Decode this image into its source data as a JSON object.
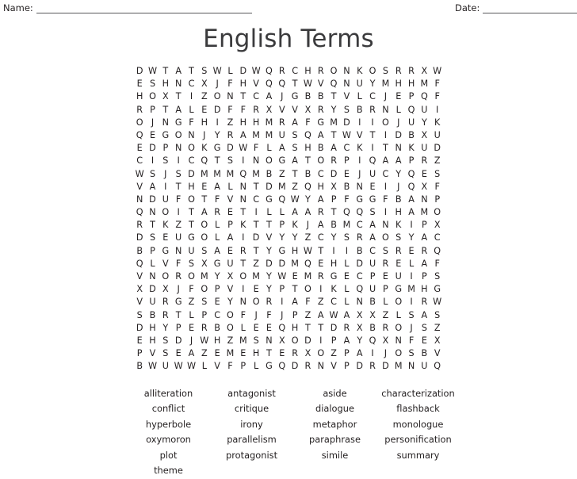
{
  "header": {
    "name_label": "Name:",
    "date_label": "Date:"
  },
  "title": "English Terms",
  "grid": {
    "columns": 24,
    "rows": [
      [
        "D",
        "W",
        "T",
        "A",
        "T",
        "S",
        "W",
        "L",
        "D",
        "W",
        "Q",
        "R",
        "C",
        "H",
        "R",
        "O",
        "N",
        "K",
        "O",
        "S",
        "R",
        "R",
        "X",
        "W"
      ],
      [
        "E",
        "S",
        "H",
        "N",
        "C",
        "X",
        "J",
        "F",
        "H",
        "V",
        "Q",
        "Q",
        "T",
        "W",
        "V",
        "Q",
        "N",
        "U",
        "Y",
        "M",
        "H",
        "H",
        "M",
        "F"
      ],
      [
        "H",
        "O",
        "X",
        "T",
        "I",
        "Z",
        "O",
        "N",
        "T",
        "C",
        "A",
        "J",
        "G",
        "B",
        "B",
        "T",
        "V",
        "L",
        "C",
        "J",
        "E",
        "P",
        "Q",
        "F"
      ],
      [
        "R",
        "P",
        "T",
        "A",
        "L",
        "E",
        "D",
        "F",
        "F",
        "R",
        "X",
        "V",
        "V",
        "X",
        "R",
        "Y",
        "S",
        "B",
        "R",
        "N",
        "L",
        "Q",
        "U",
        "I"
      ],
      [
        "O",
        "J",
        "N",
        "G",
        "F",
        "H",
        "I",
        "Z",
        "H",
        "H",
        "M",
        "R",
        "A",
        "F",
        "G",
        "M",
        "D",
        "I",
        "I",
        "O",
        "J",
        "U",
        "Y",
        "K"
      ],
      [
        "Q",
        "E",
        "G",
        "O",
        "N",
        "J",
        "Y",
        "R",
        "A",
        "M",
        "M",
        "U",
        "S",
        "Q",
        "A",
        "T",
        "W",
        "V",
        "T",
        "I",
        "D",
        "B",
        "X",
        "U"
      ],
      [
        "E",
        "D",
        "P",
        "N",
        "O",
        "K",
        "G",
        "D",
        "W",
        "F",
        "L",
        "A",
        "S",
        "H",
        "B",
        "A",
        "C",
        "K",
        "I",
        "T",
        "N",
        "K",
        "U",
        "D"
      ],
      [
        "C",
        "I",
        "S",
        "I",
        "C",
        "Q",
        "T",
        "S",
        "I",
        "N",
        "O",
        "G",
        "A",
        "T",
        "O",
        "R",
        "P",
        "I",
        "Q",
        "A",
        "A",
        "P",
        "R",
        "Z"
      ],
      [
        "W",
        "S",
        "J",
        "S",
        "D",
        "M",
        "M",
        "M",
        "Q",
        "M",
        "B",
        "Z",
        "T",
        "B",
        "C",
        "D",
        "E",
        "J",
        "U",
        "C",
        "Y",
        "Q",
        "E",
        "S"
      ],
      [
        "V",
        "A",
        "I",
        "T",
        "H",
        "E",
        "A",
        "L",
        "N",
        "T",
        "D",
        "M",
        "Z",
        "Q",
        "H",
        "X",
        "B",
        "N",
        "E",
        "I",
        "J",
        "Q",
        "X",
        "F"
      ],
      [
        "N",
        "D",
        "U",
        "F",
        "O",
        "T",
        "F",
        "V",
        "N",
        "C",
        "G",
        "Q",
        "W",
        "Y",
        "A",
        "P",
        "F",
        "G",
        "G",
        "F",
        "B",
        "A",
        "N",
        "P"
      ],
      [
        "Q",
        "N",
        "O",
        "I",
        "T",
        "A",
        "R",
        "E",
        "T",
        "I",
        "L",
        "L",
        "A",
        "A",
        "R",
        "T",
        "Q",
        "Q",
        "S",
        "I",
        "H",
        "A",
        "M",
        "O"
      ],
      [
        "R",
        "T",
        "K",
        "Z",
        "T",
        "O",
        "L",
        "P",
        "K",
        "T",
        "T",
        "P",
        "K",
        "J",
        "A",
        "B",
        "M",
        "C",
        "A",
        "N",
        "K",
        "I",
        "P",
        "X"
      ],
      [
        "D",
        "S",
        "E",
        "U",
        "G",
        "O",
        "L",
        "A",
        "I",
        "D",
        "V",
        "Y",
        "Y",
        "Z",
        "C",
        "Y",
        "S",
        "R",
        "A",
        "O",
        "S",
        "Y",
        "A",
        "C"
      ],
      [
        "B",
        "P",
        "G",
        "N",
        "U",
        "S",
        "A",
        "E",
        "R",
        "T",
        "Y",
        "G",
        "H",
        "W",
        "T",
        "I",
        "I",
        "B",
        "C",
        "S",
        "R",
        "E",
        "R",
        "Q"
      ],
      [
        "Q",
        "L",
        "V",
        "F",
        "S",
        "X",
        "G",
        "U",
        "T",
        "Z",
        "D",
        "D",
        "M",
        "Q",
        "E",
        "H",
        "L",
        "D",
        "U",
        "R",
        "E",
        "L",
        "A",
        "F"
      ],
      [
        "V",
        "N",
        "O",
        "R",
        "O",
        "M",
        "Y",
        "X",
        "O",
        "M",
        "Y",
        "W",
        "E",
        "M",
        "R",
        "G",
        "E",
        "C",
        "P",
        "E",
        "U",
        "I",
        "P",
        "S"
      ],
      [
        "X",
        "D",
        "X",
        "J",
        "F",
        "O",
        "P",
        "V",
        "I",
        "E",
        "Y",
        "P",
        "T",
        "O",
        "I",
        "K",
        "L",
        "Q",
        "U",
        "P",
        "G",
        "M",
        "H",
        "G"
      ],
      [
        "V",
        "U",
        "R",
        "G",
        "Z",
        "S",
        "E",
        "Y",
        "N",
        "O",
        "R",
        "I",
        "A",
        "F",
        "Z",
        "C",
        "L",
        "N",
        "B",
        "L",
        "O",
        "I",
        "R",
        "W"
      ],
      [
        "S",
        "B",
        "R",
        "T",
        "L",
        "P",
        "C",
        "O",
        "F",
        "J",
        "F",
        "J",
        "P",
        "Z",
        "A",
        "W",
        "A",
        "X",
        "X",
        "Z",
        "L",
        "S",
        "A",
        "S"
      ],
      [
        "D",
        "H",
        "Y",
        "P",
        "E",
        "R",
        "B",
        "O",
        "L",
        "E",
        "E",
        "Q",
        "H",
        "T",
        "T",
        "D",
        "R",
        "X",
        "B",
        "R",
        "O",
        "J",
        "S",
        "Z"
      ],
      [
        "E",
        "H",
        "S",
        "D",
        "J",
        "W",
        "H",
        "Z",
        "M",
        "S",
        "N",
        "X",
        "O",
        "D",
        "I",
        "P",
        "A",
        "Y",
        "Q",
        "X",
        "N",
        "F",
        "E",
        "X"
      ],
      [
        "P",
        "V",
        "S",
        "E",
        "A",
        "Z",
        "E",
        "M",
        "E",
        "H",
        "T",
        "E",
        "R",
        "X",
        "O",
        "Z",
        "P",
        "A",
        "I",
        "J",
        "O",
        "S",
        "B",
        "V"
      ],
      [
        "B",
        "W",
        "U",
        "W",
        "W",
        "L",
        "V",
        "F",
        "P",
        "L",
        "G",
        "Q",
        "D",
        "R",
        "N",
        "V",
        "P",
        "D",
        "R",
        "D",
        "M",
        "N",
        "U",
        "Q"
      ]
    ]
  },
  "wordlist": {
    "rows": [
      [
        "alliteration",
        "antagonist",
        "aside",
        "characterization"
      ],
      [
        "conflict",
        "critique",
        "dialogue",
        "flashback"
      ],
      [
        "hyperbole",
        "irony",
        "metaphor",
        "monologue"
      ],
      [
        "oxymoron",
        "parallelism",
        "paraphrase",
        "personification"
      ],
      [
        "plot",
        "protagonist",
        "simile",
        "summary"
      ],
      [
        "theme",
        "",
        "",
        ""
      ]
    ]
  }
}
